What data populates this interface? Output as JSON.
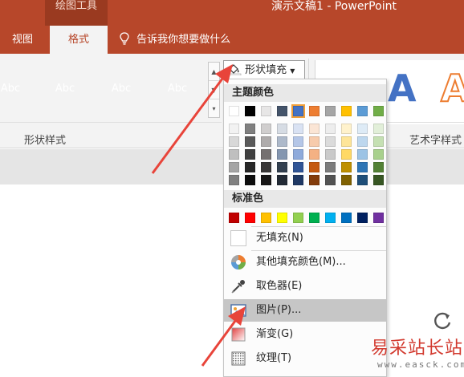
{
  "titlebar": {
    "context_group": "绘图工具",
    "app_title": "演示文稿1  -  PowerPoint",
    "bg_color": "#b7472a"
  },
  "tabs": {
    "view": "视图",
    "format": "格式",
    "tell_me": "告诉我你想要做什么"
  },
  "ribbon": {
    "shape_styles": {
      "group_label": "形状样式",
      "items": [
        {
          "label": "Abc",
          "color": "#a5a5a5"
        },
        {
          "label": "Abc",
          "color": "#ffc000"
        },
        {
          "label": "Abc",
          "color": "#5b9bd5"
        },
        {
          "label": "Abc",
          "color": "#70ad47"
        }
      ]
    },
    "shape_fill": {
      "label": "形状填充",
      "dropdown_icon": "chevron-down-icon"
    },
    "wordart": {
      "group_label": "艺术字样式",
      "samples": [
        "A",
        "A"
      ]
    }
  },
  "menu": {
    "theme_colors_header": "主题颜色",
    "standard_colors_header": "标准色",
    "theme_top_row": [
      "#ffffff",
      "#000000",
      "#e7e6e6",
      "#44546a",
      "#4472c4",
      "#ed7d31",
      "#a5a5a5",
      "#ffc000",
      "#5b9bd5",
      "#70ad47"
    ],
    "theme_shades": [
      [
        "#f2f2f2",
        "#7f7f7f",
        "#d0cece",
        "#d6dce4",
        "#d9e2f3",
        "#fbe5d5",
        "#ededed",
        "#fff2cc",
        "#deebf6",
        "#e2efd9"
      ],
      [
        "#d8d8d8",
        "#595959",
        "#aeabab",
        "#adb9ca",
        "#b4c6e7",
        "#f7cbac",
        "#dbdbdb",
        "#fee599",
        "#bdd7ee",
        "#c5e0b3"
      ],
      [
        "#bfbfbf",
        "#3f3f3f",
        "#757070",
        "#8496b0",
        "#8eaadb",
        "#f4b183",
        "#c9c9c9",
        "#ffd965",
        "#9cc3e5",
        "#a8d08d"
      ],
      [
        "#a5a5a5",
        "#262626",
        "#3a3838",
        "#323f4f",
        "#2f5496",
        "#c55a11",
        "#7b7b7b",
        "#bf9000",
        "#2e75b5",
        "#538135"
      ],
      [
        "#7f7f7f",
        "#0c0c0c",
        "#171616",
        "#222a35",
        "#1f3864",
        "#833c0b",
        "#525252",
        "#7f6000",
        "#1e4e79",
        "#375623"
      ]
    ],
    "standard_colors": [
      "#c00000",
      "#ff0000",
      "#ffc000",
      "#ffff00",
      "#92d050",
      "#00b050",
      "#00b0f0",
      "#0070c0",
      "#002060",
      "#7030a0"
    ],
    "items": {
      "no_fill": "无填充(N)",
      "more_colors": "其他填充颜色(M)...",
      "eyedropper": "取色器(E)",
      "picture": "图片(P)...",
      "gradient": "渐变(G)",
      "texture": "纹理(T)"
    }
  },
  "watermark": {
    "title": "易采站长站",
    "url": "www.easck.com"
  },
  "annotation_color": "#e8443a"
}
